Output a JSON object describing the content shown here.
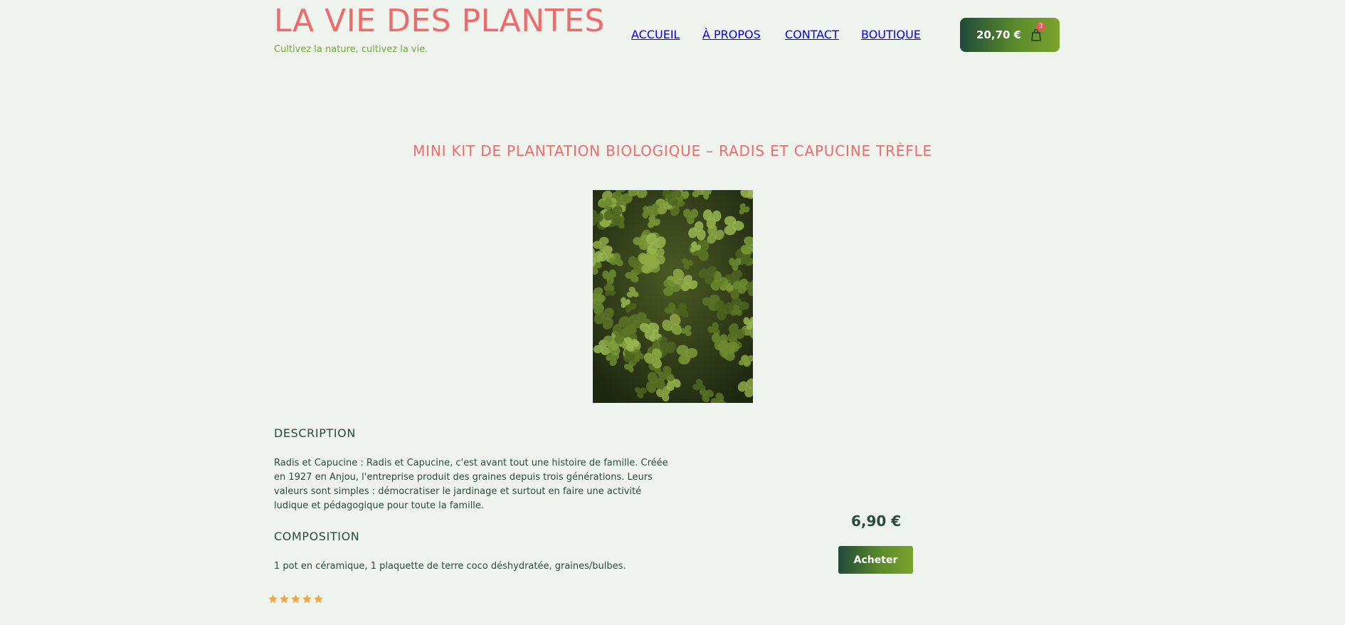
{
  "site": {
    "title": "LA VIE DES PLANTES",
    "tagline": "Cultivez la nature, cultivez la vie."
  },
  "nav": {
    "items": [
      {
        "label": "ACCUEIL"
      },
      {
        "label": "À PROPOS"
      },
      {
        "label": "CONTACT"
      },
      {
        "label": "BOUTIQUE"
      }
    ]
  },
  "cart": {
    "total": "20,70 €",
    "count": "3",
    "icon": "shopping-bag-icon"
  },
  "product": {
    "title": "MINI KIT DE PLANTATION BIOLOGIQUE – RADIS ET CAPUCINE TRÈFLE",
    "image_alt": "Trèfle",
    "description_heading": "DESCRIPTION",
    "description": "Radis et Capucine : Radis et Capucine, c'est avant tout une histoire de famille. Créée en 1927 en Anjou, l'entreprise produit des graines depuis trois générations. Leurs valeurs sont simples : démocratiser le jardinage et surtout en faire une activité ludique et pédagogique pour toute la famille.",
    "composition_heading": "COMPOSITION",
    "composition": "1 pot en céramique, 1 plaquette de terre coco déshydratée, graines/bulbes.",
    "price": "6,90 €",
    "buy_label": "Acheter",
    "rating": {
      "value": 5,
      "max": 5
    }
  },
  "colors": {
    "background": "#eef3ee",
    "accent_pink": "#ef6b6a",
    "accent_green": "#7aa23a",
    "dark_green": "#1f4a3a",
    "text": "#2b4a3c",
    "star": "#f0a848",
    "badge": "#e25b4e"
  }
}
